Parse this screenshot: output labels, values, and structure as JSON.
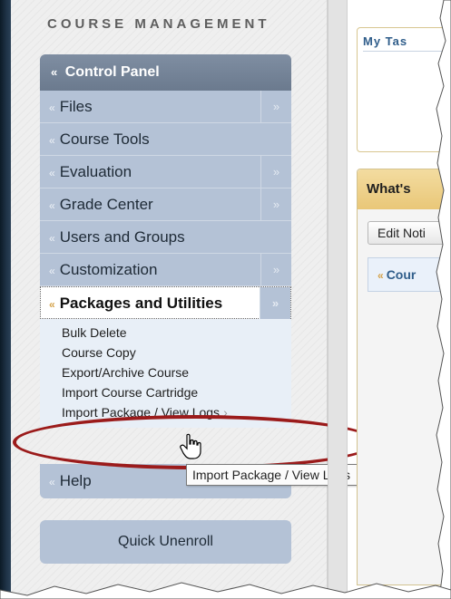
{
  "sidebar": {
    "title": "COURSE MANAGEMENT",
    "control_panel": "Control Panel",
    "items": [
      {
        "label": "Files",
        "has_arrow": true
      },
      {
        "label": "Course Tools",
        "has_arrow": false
      },
      {
        "label": "Evaluation",
        "has_arrow": true
      },
      {
        "label": "Grade Center",
        "has_arrow": true
      },
      {
        "label": "Users and Groups",
        "has_arrow": false
      },
      {
        "label": "Customization",
        "has_arrow": true
      }
    ],
    "active_item": "Packages and Utilities",
    "submenu": [
      "Bulk Delete",
      "Course Copy",
      "Export/Archive Course",
      "Import Course Cartridge",
      "Import Package / View Logs"
    ],
    "help": "Help",
    "quick_unenroll": "Quick Unenroll"
  },
  "tooltip": "Import Package / View Logs",
  "right_panel": {
    "tasks_title": "My Tas",
    "whats_title": "What's",
    "edit_button": "Edit Noti",
    "course_item": "Cour"
  },
  "colors": {
    "menu_bg": "#b4c2d6",
    "header_bg": "#7f8ea2",
    "annotation_red": "#9b1b1b",
    "accent_gold": "#d4a24a"
  }
}
